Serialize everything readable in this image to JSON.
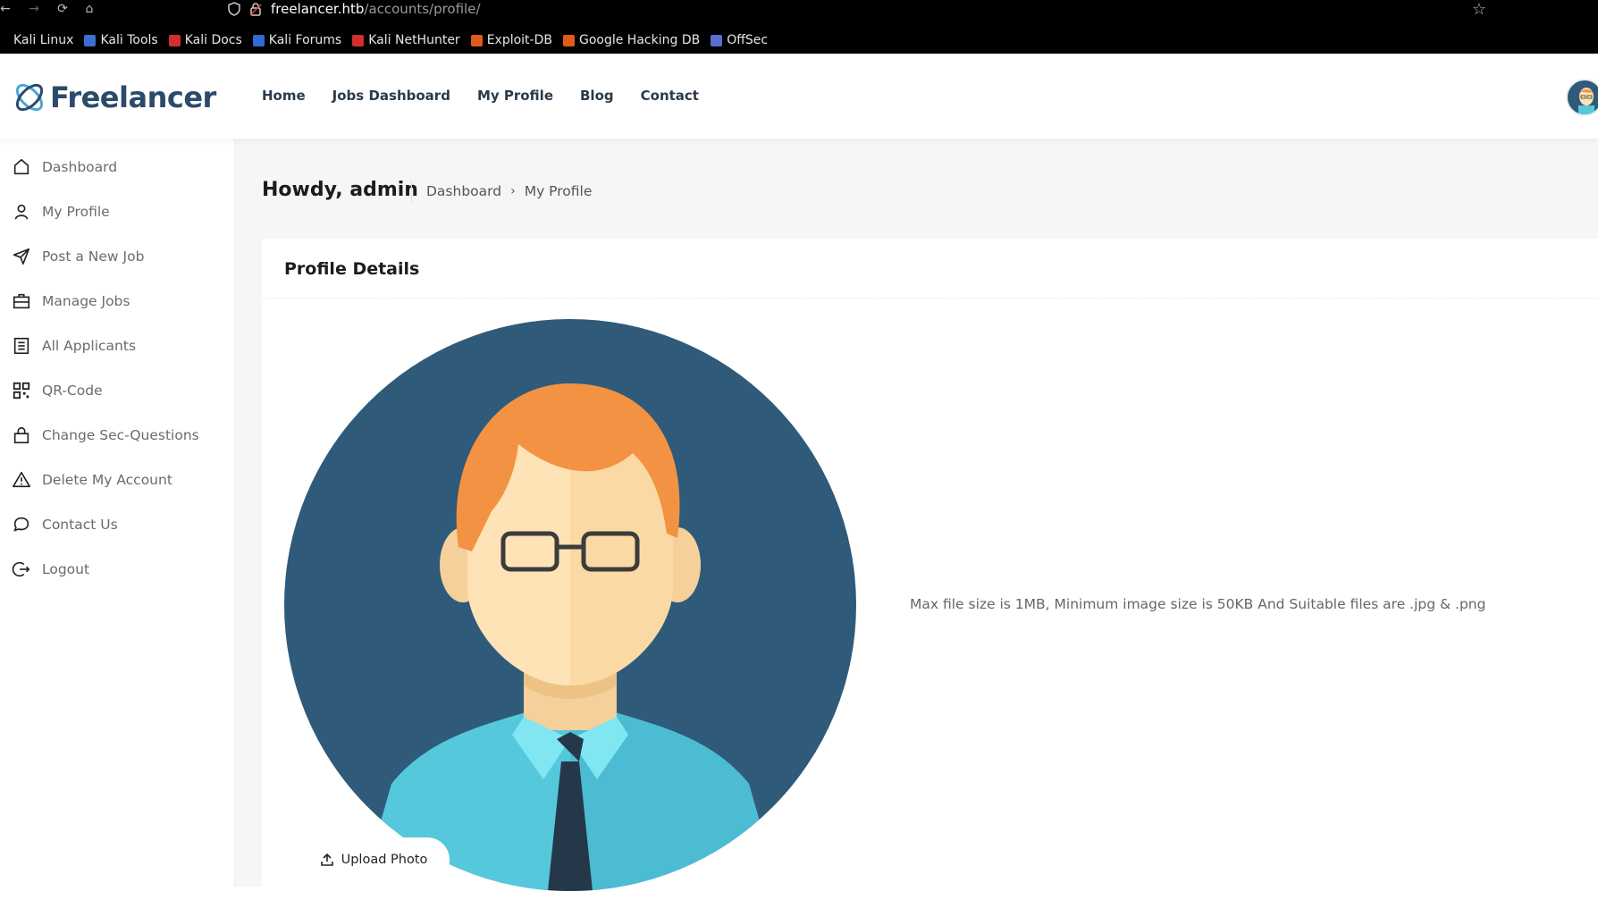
{
  "browser": {
    "url_host": "freelancer.htb",
    "url_path": "/accounts/profile/",
    "bookmarks": [
      {
        "label": "Kali Linux",
        "color": "#000000"
      },
      {
        "label": "Kali Tools",
        "color": "#3c6fd1"
      },
      {
        "label": "Kali Docs",
        "color": "#d12f2f"
      },
      {
        "label": "Kali Forums",
        "color": "#2f6bd1"
      },
      {
        "label": "Kali NetHunter",
        "color": "#d12f2f"
      },
      {
        "label": "Exploit-DB",
        "color": "#e05a1a"
      },
      {
        "label": "Google Hacking DB",
        "color": "#e05a1a"
      },
      {
        "label": "OffSec",
        "color": "#5b6fd1"
      }
    ]
  },
  "header": {
    "logo_text": "Freelancer",
    "nav": [
      "Home",
      "Jobs Dashboard",
      "My Profile",
      "Blog",
      "Contact"
    ]
  },
  "sidebar": {
    "items": [
      {
        "label": "Dashboard",
        "icon": "home-icon"
      },
      {
        "label": "My Profile",
        "icon": "user-icon"
      },
      {
        "label": "Post a New Job",
        "icon": "send-icon"
      },
      {
        "label": "Manage Jobs",
        "icon": "briefcase-icon"
      },
      {
        "label": "All Applicants",
        "icon": "list-icon"
      },
      {
        "label": "QR-Code",
        "icon": "qr-icon"
      },
      {
        "label": "Change Sec-Questions",
        "icon": "lock-icon"
      },
      {
        "label": "Delete My Account",
        "icon": "warning-icon"
      },
      {
        "label": "Contact Us",
        "icon": "chat-icon"
      },
      {
        "label": "Logout",
        "icon": "logout-icon"
      }
    ]
  },
  "main": {
    "greeting": "Howdy, admin",
    "breadcrumb": [
      "Dashboard",
      "My Profile"
    ],
    "card_title": "Profile Details",
    "upload_label": "Upload Photo",
    "file_hint": "Max file size is 1MB, Minimum image size is 50KB And Suitable files are .jpg & .png"
  },
  "colors": {
    "brand": "#2c4a6b",
    "avatar_bg": "#2f5a7a",
    "hair": "#f39242",
    "shirt": "#55c8dc"
  }
}
